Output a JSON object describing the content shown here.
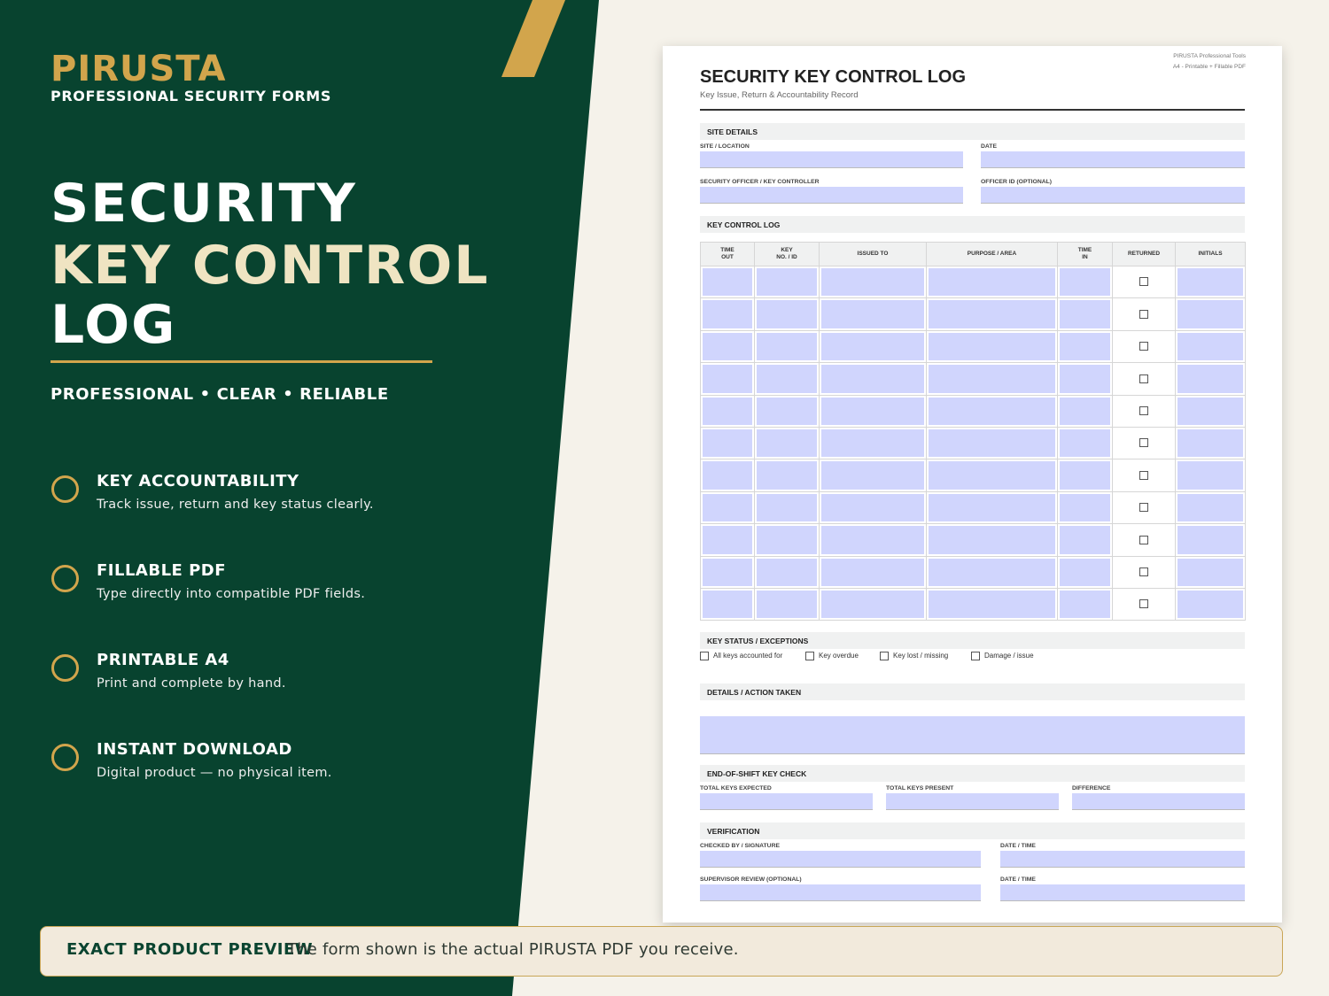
{
  "brand": {
    "name": "PIRUSTA",
    "tagline": "PROFESSIONAL SECURITY FORMS"
  },
  "hero": {
    "line1": "SECURITY",
    "line2": "KEY CONTROL",
    "line3": "LOG",
    "qualities": "PROFESSIONAL  •  CLEAR  •  RELIABLE"
  },
  "features": [
    {
      "title": "KEY ACCOUNTABILITY",
      "desc": "Track issue, return and key status clearly."
    },
    {
      "title": "FILLABLE PDF",
      "desc": "Type directly into compatible PDF fields."
    },
    {
      "title": "PRINTABLE A4",
      "desc": "Print and complete by hand."
    },
    {
      "title": "INSTANT DOWNLOAD",
      "desc": "Digital product — no physical item."
    }
  ],
  "banner": {
    "strong": "EXACT PRODUCT PREVIEW",
    "text": "The form shown is the actual PIRUSTA PDF you receive."
  },
  "colors": {
    "green": "#08432f",
    "gold": "#d2a54c",
    "cream": "#f5f2ea",
    "field": "#d0d5fd"
  },
  "doc": {
    "title": "SECURITY KEY CONTROL LOG",
    "subtitle": "Key Issue, Return & Accountability Record",
    "meta1": "PIRUSTA Professional Tools",
    "meta2": "A4 - Printable + Fillable PDF",
    "site_section": "SITE DETAILS",
    "site_label": "SITE / LOCATION",
    "date_label": "DATE",
    "officer_label": "SECURITY OFFICER / KEY CONTROLLER",
    "officer_id_label": "OFFICER ID (OPTIONAL)",
    "log_section": "KEY CONTROL LOG",
    "columns": [
      "TIME\nOUT",
      "KEY\nNO. / ID",
      "ISSUED TO",
      "PURPOSE / AREA",
      "TIME\nIN",
      "RETURNED",
      "INITIALS"
    ],
    "row_count": 11,
    "status_section": "KEY STATUS / EXCEPTIONS",
    "status_options": [
      "All keys accounted for",
      "Key overdue",
      "Key lost / missing",
      "Damage / issue"
    ],
    "details_section": "DETAILS / ACTION TAKEN",
    "eos_section": "END-OF-SHIFT KEY CHECK",
    "eos_labels": [
      "TOTAL KEYS EXPECTED",
      "TOTAL KEYS PRESENT",
      "DIFFERENCE"
    ],
    "verify_section": "VERIFICATION",
    "checked_label": "CHECKED BY / SIGNATURE",
    "datetime_label_1": "DATE / TIME",
    "supervisor_label": "SUPERVISOR REVIEW (OPTIONAL)",
    "datetime_label_2": "DATE / TIME"
  }
}
